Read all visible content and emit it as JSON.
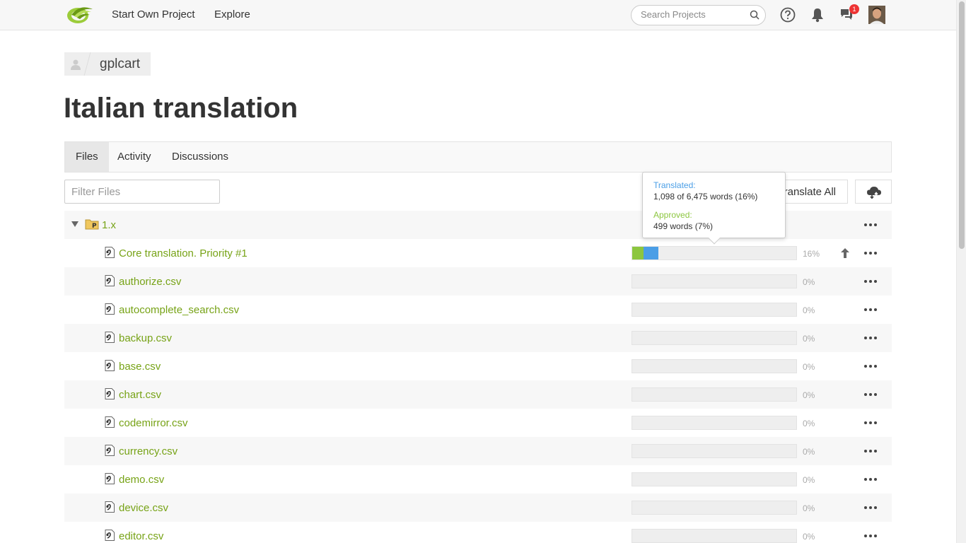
{
  "nav": {
    "start_project": "Start Own Project",
    "explore": "Explore",
    "search_placeholder": "Search Projects",
    "notification_count": "1"
  },
  "breadcrumb": {
    "project": "gplcart"
  },
  "page_title": "Italian translation",
  "tabs": [
    {
      "label": "Files",
      "active": true
    },
    {
      "label": "Activity",
      "active": false
    },
    {
      "label": "Discussions",
      "active": false
    }
  ],
  "filter_placeholder": "Filter Files",
  "translate_all_label": "Translate All",
  "folder": {
    "name": "1.x"
  },
  "files": [
    {
      "name": "Core translation. Priority #1",
      "percent": "16%",
      "translated": 0.16,
      "approved": 0.07
    },
    {
      "name": "authorize.csv",
      "percent": "0%",
      "translated": 0,
      "approved": 0
    },
    {
      "name": "autocomplete_search.csv",
      "percent": "0%",
      "translated": 0,
      "approved": 0
    },
    {
      "name": "backup.csv",
      "percent": "0%",
      "translated": 0,
      "approved": 0
    },
    {
      "name": "base.csv",
      "percent": "0%",
      "translated": 0,
      "approved": 0
    },
    {
      "name": "chart.csv",
      "percent": "0%",
      "translated": 0,
      "approved": 0
    },
    {
      "name": "codemirror.csv",
      "percent": "0%",
      "translated": 0,
      "approved": 0
    },
    {
      "name": "currency.csv",
      "percent": "0%",
      "translated": 0,
      "approved": 0
    },
    {
      "name": "demo.csv",
      "percent": "0%",
      "translated": 0,
      "approved": 0
    },
    {
      "name": "device.csv",
      "percent": "0%",
      "translated": 0,
      "approved": 0
    },
    {
      "name": "editor.csv",
      "percent": "0%",
      "translated": 0,
      "approved": 0
    }
  ],
  "tooltip": {
    "translated_label": "Translated:",
    "translated_value": "1,098 of 6,475 words (16%)",
    "approved_label": "Approved:",
    "approved_value": "499 words (7%)"
  },
  "colors": {
    "link_green": "#77a317",
    "translated_blue": "#4a9ee6",
    "approved_green": "#8cc63f"
  }
}
